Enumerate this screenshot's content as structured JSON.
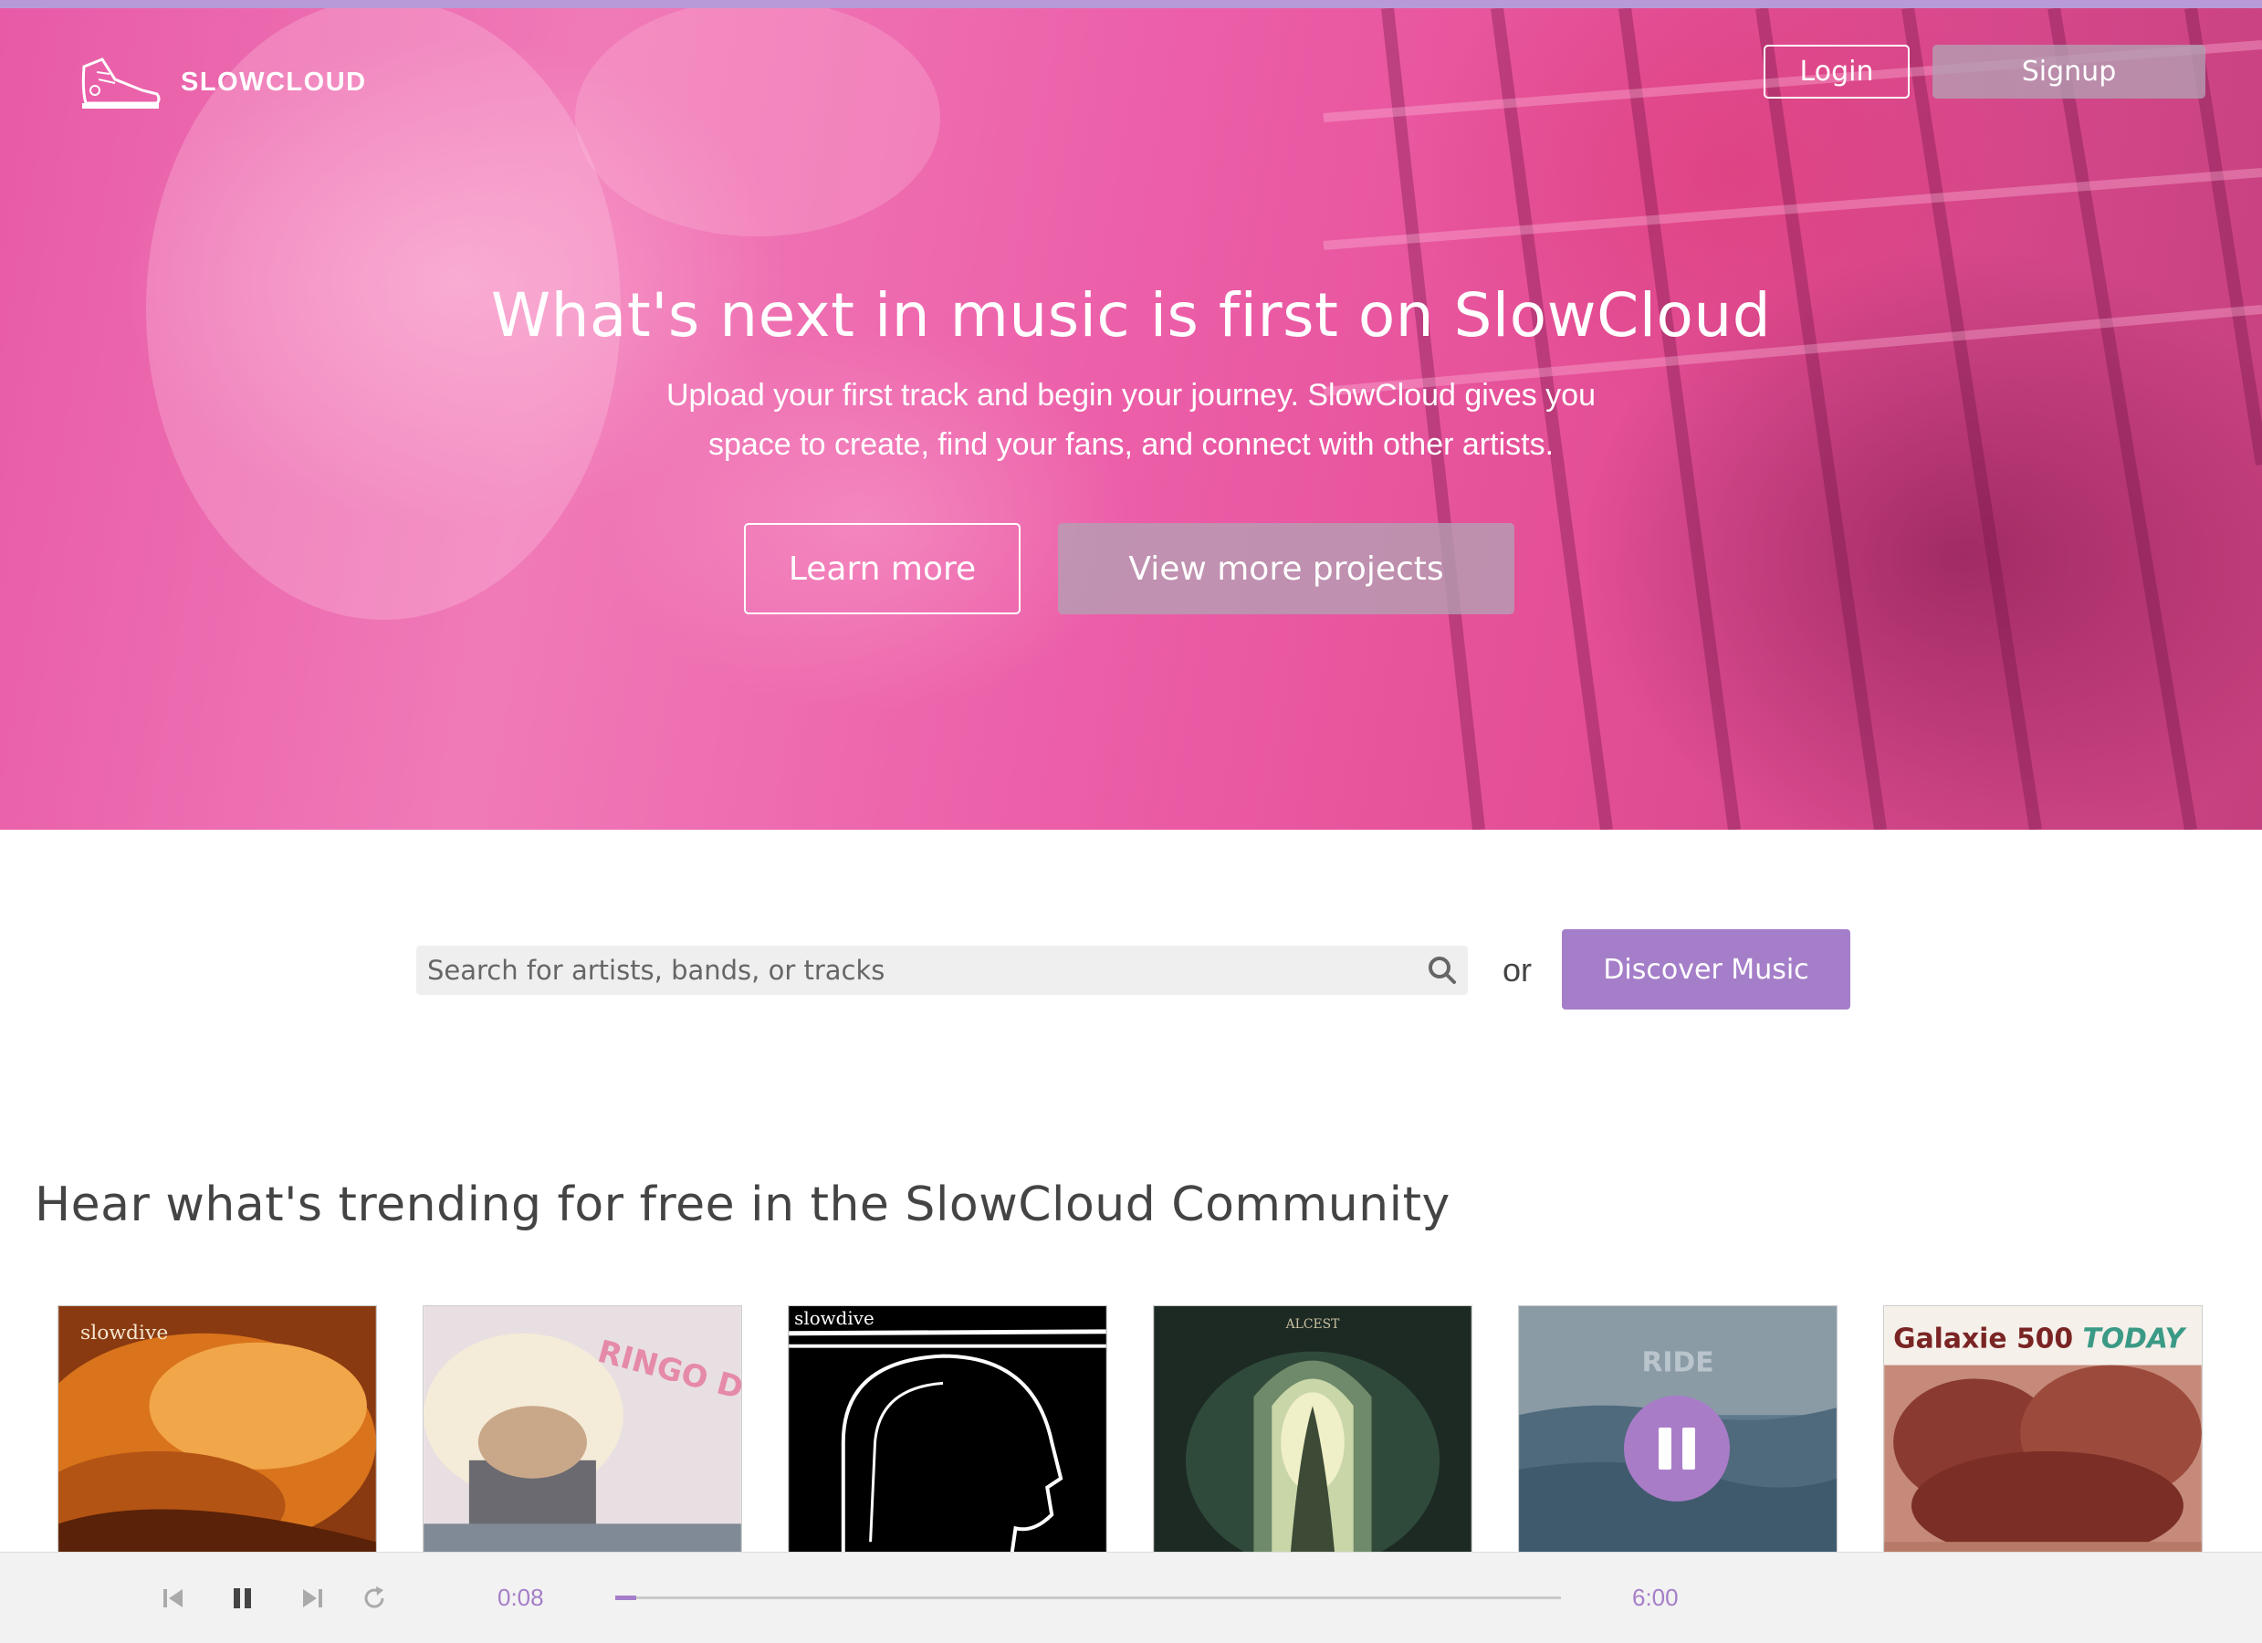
{
  "brand": {
    "name": "SLOWCLOUD",
    "logo_icon": "sneaker-icon"
  },
  "nav": {
    "login": "Login",
    "signup": "Signup"
  },
  "hero": {
    "title": "What's next in music is first on SlowCloud",
    "subtitle_line1": "Upload your first track and begin your journey. SlowCloud gives you",
    "subtitle_line2": "space to create, find your fans, and connect with other artists.",
    "learn_more": "Learn more",
    "view_projects": "View more projects"
  },
  "search": {
    "placeholder": "Search for artists, bands, or tracks",
    "or": "or",
    "discover": "Discover Music"
  },
  "trending": {
    "title": "Hear what's trending for free in the SlowCloud Community",
    "albums": [
      {
        "cover_text": "slowdive"
      },
      {
        "cover_text": "RINGO DEATHSTARR COLOUR TRIP"
      },
      {
        "cover_text": "slowdive"
      },
      {
        "cover_text": "ALCEST"
      },
      {
        "cover_text": "RIDE",
        "playing": true
      },
      {
        "cover_text_1": "Galaxie 500",
        "cover_text_2": "TODAY"
      }
    ]
  },
  "player": {
    "current_time": "0:08",
    "total_time": "6:00",
    "progress": 0.022
  },
  "colors": {
    "accent": "#a57ec9",
    "topbar": "#b89ad8",
    "hero_pink": "#ec5ea8"
  }
}
